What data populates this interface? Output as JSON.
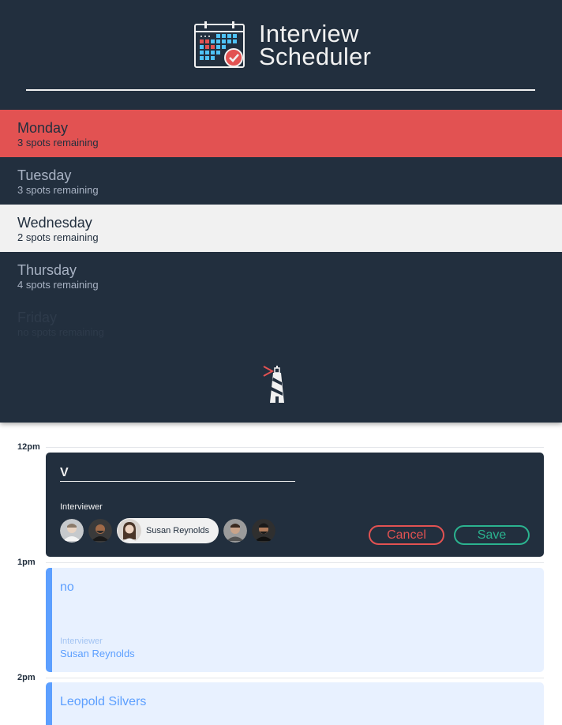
{
  "header": {
    "title_line1": "Interview",
    "title_line2": "Scheduler"
  },
  "days": [
    {
      "name": "Monday",
      "spots": "3 spots remaining",
      "state": "hover"
    },
    {
      "name": "Tuesday",
      "spots": "3 spots remaining",
      "state": "default"
    },
    {
      "name": "Wednesday",
      "spots": "2 spots remaining",
      "state": "selected"
    },
    {
      "name": "Thursday",
      "spots": "4 spots remaining",
      "state": "default"
    },
    {
      "name": "Friday",
      "spots": "no spots remaining",
      "state": "full"
    }
  ],
  "schedule": {
    "times": [
      "12pm",
      "1pm",
      "2pm"
    ],
    "form": {
      "student_value": "V",
      "interviewer_heading": "Interviewer",
      "selected_interviewer": "Susan Reynolds",
      "cancel_label": "Cancel",
      "save_label": "Save"
    },
    "appointments": [
      {
        "student": "no",
        "interviewer_label": "Interviewer",
        "interviewer": "Susan Reynolds"
      },
      {
        "student": "Leopold Silvers"
      }
    ]
  },
  "colors": {
    "sidebar_bg": "#222f3e",
    "accent_red": "#e25252",
    "selected_bg": "#f1f1f1",
    "appointment_blue": "#5c9fff",
    "save_green": "#2bb38f"
  }
}
